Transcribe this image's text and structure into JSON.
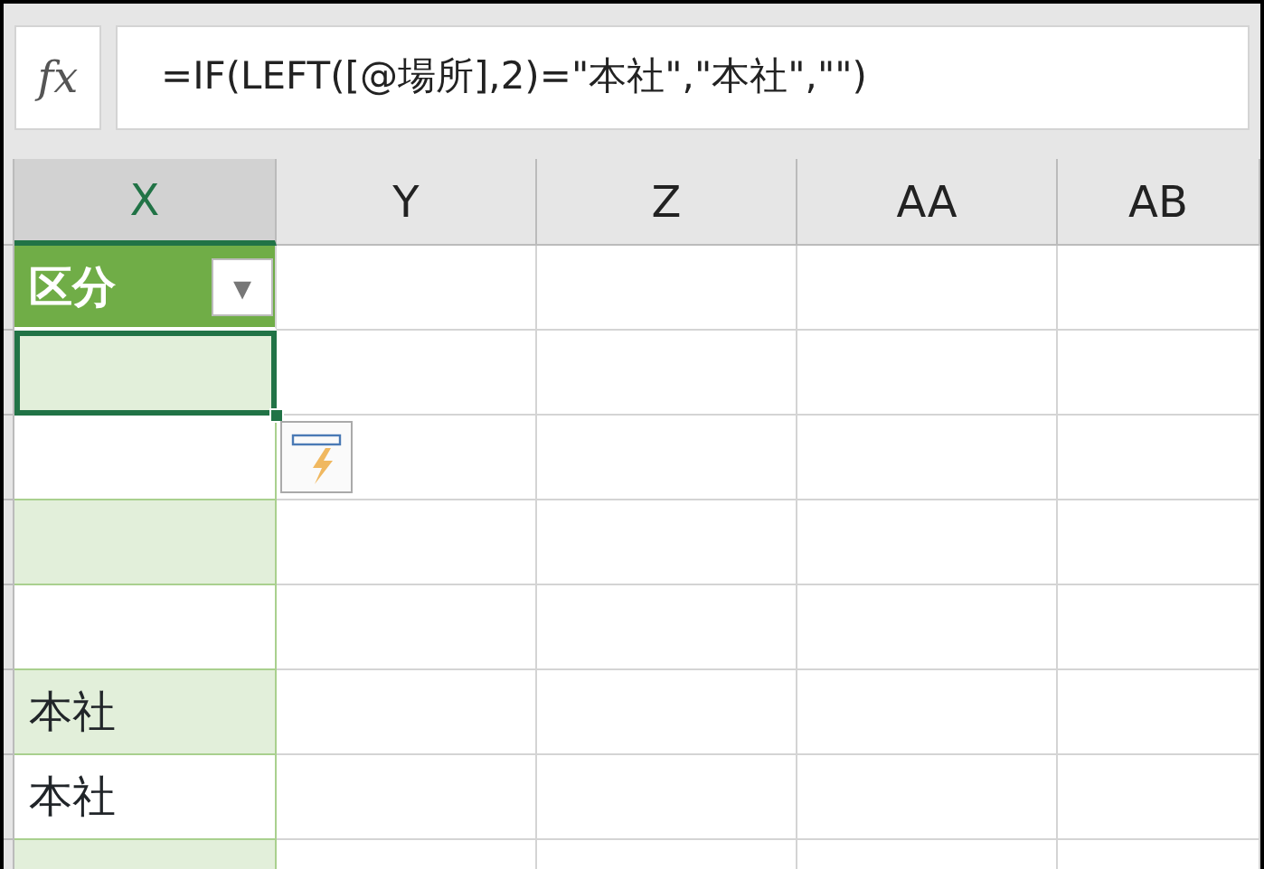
{
  "formula_bar": {
    "function_label": "fx",
    "formula": "=IF(LEFT([@場所],2)=\"本社\",\"本社\",\"\")"
  },
  "columns": [
    {
      "label": "X",
      "selected": true
    },
    {
      "label": "Y",
      "selected": false
    },
    {
      "label": "Z",
      "selected": false
    },
    {
      "label": "AA",
      "selected": false
    },
    {
      "label": "AB",
      "selected": false
    }
  ],
  "table_header": {
    "label": "区分",
    "filter_button": "▾"
  },
  "rows": [
    {
      "selected": true
    },
    {
      "selected": false
    },
    {
      "selected": false
    },
    {
      "selected": false
    },
    {
      "selected": false,
      "value": "本社"
    },
    {
      "selected": false,
      "value": "本社"
    },
    {
      "selected": false
    }
  ]
}
